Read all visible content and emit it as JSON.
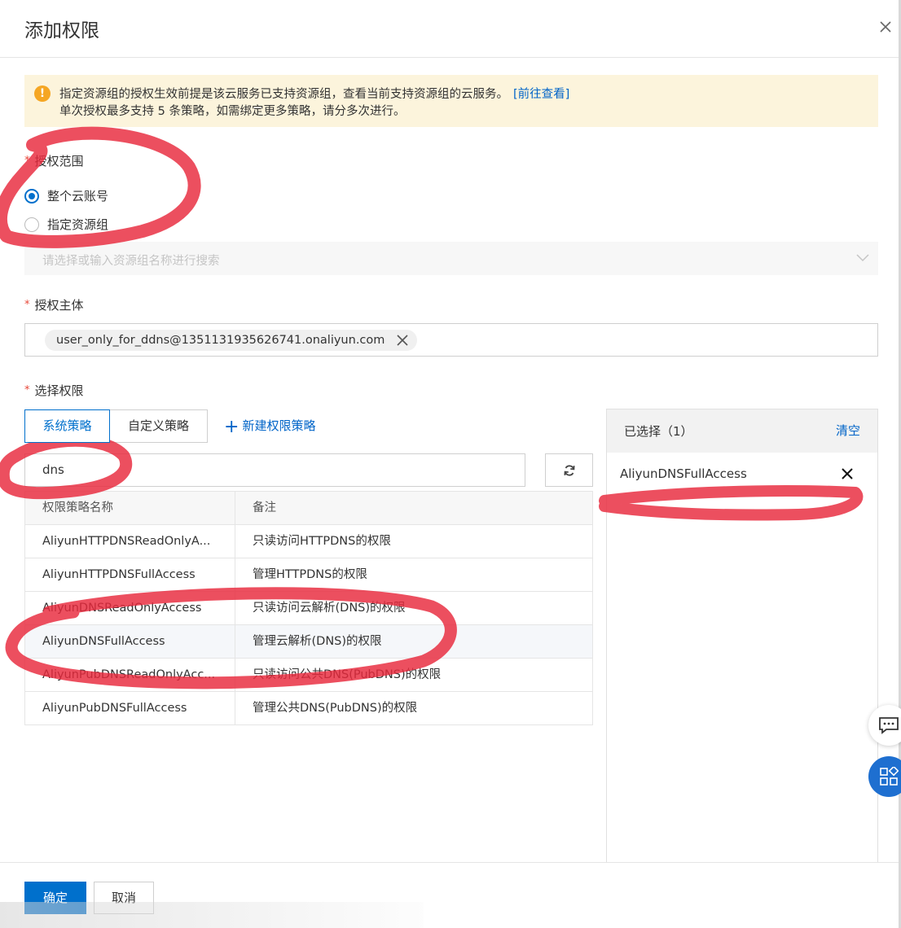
{
  "dialog": {
    "title": "添加权限"
  },
  "notice": {
    "line1": "指定资源组的授权生效前提是该云服务已支持资源组，查看当前支持资源组的云服务。",
    "link": "[前往查看]",
    "line2": "单次授权最多支持 5 条策略，如需绑定更多策略，请分多次进行。",
    "icon": "warning-icon"
  },
  "scope": {
    "label": "授权范围",
    "options": [
      "整个云账号",
      "指定资源组"
    ],
    "selected": "整个云账号",
    "resource_group_placeholder": "请选择或输入资源组名称进行搜索"
  },
  "principal": {
    "label": "授权主体",
    "tag": "user_only_for_ddns@1351131935626741.onaliyun.com"
  },
  "permissions": {
    "label": "选择权限",
    "tabs": [
      "系统策略",
      "自定义策略"
    ],
    "active_tab": "系统策略",
    "new_policy": "新建权限策略",
    "search_value": "dns",
    "columns": [
      "权限策略名称",
      "备注"
    ],
    "rows": [
      {
        "name": "AliyunHTTPDNSReadOnlyA...",
        "note": "只读访问HTTPDNS的权限"
      },
      {
        "name": "AliyunHTTPDNSFullAccess",
        "note": "管理HTTPDNS的权限"
      },
      {
        "name": "AliyunDNSReadOnlyAccess",
        "note": "只读访问云解析(DNS)的权限"
      },
      {
        "name": "AliyunDNSFullAccess",
        "note": "管理云解析(DNS)的权限"
      },
      {
        "name": "AliyunPubDNSReadOnlyAcc...",
        "note": "只读访问公共DNS(PubDNS)的权限"
      },
      {
        "name": "AliyunPubDNSFullAccess",
        "note": "管理公共DNS(PubDNS)的权限"
      }
    ]
  },
  "selected": {
    "title": "已选择（1）",
    "clear": "清空",
    "items": [
      "AliyunDNSFullAccess"
    ]
  },
  "footer": {
    "ok": "确定",
    "cancel": "取消"
  },
  "colors": {
    "primary": "#0070cc",
    "link": "#0064c8",
    "notice_bg": "#fcf4dc",
    "warning": "#f5a623",
    "required": "#e84738",
    "annotation": "#e8283c"
  }
}
